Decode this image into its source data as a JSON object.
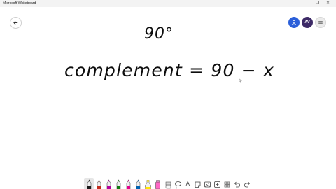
{
  "window": {
    "title": "Microsoft Whiteboard",
    "minimize": "–",
    "restore": "❐",
    "close": "✕"
  },
  "header": {
    "avatar_initials": "AV"
  },
  "board": {
    "line1": "90°",
    "line2": "complement = 90 − x"
  },
  "colors": {
    "accent": "#2b5fd9",
    "avatar_bg": "#3d2a66",
    "pen_black": "#1a1a1a",
    "pen_red": "#c42b1c",
    "pen_magenta": "#b4009e",
    "pen_green": "#107c10",
    "pen_pink": "#e3008c",
    "pen_blue": "#0063b1",
    "highlighter_yellow": "#ffe600",
    "highlighter_pink": "#ff66c4"
  },
  "toolbar": {
    "text_tool_label": "A",
    "tools": [
      "pen-black",
      "pen-red",
      "pen-magenta",
      "pen-green",
      "pen-pink",
      "pen-blue",
      "highlighter-yellow",
      "highlighter-pink",
      "eraser",
      "lasso",
      "text",
      "sticky-note",
      "image",
      "add",
      "more",
      "undo",
      "redo"
    ]
  }
}
